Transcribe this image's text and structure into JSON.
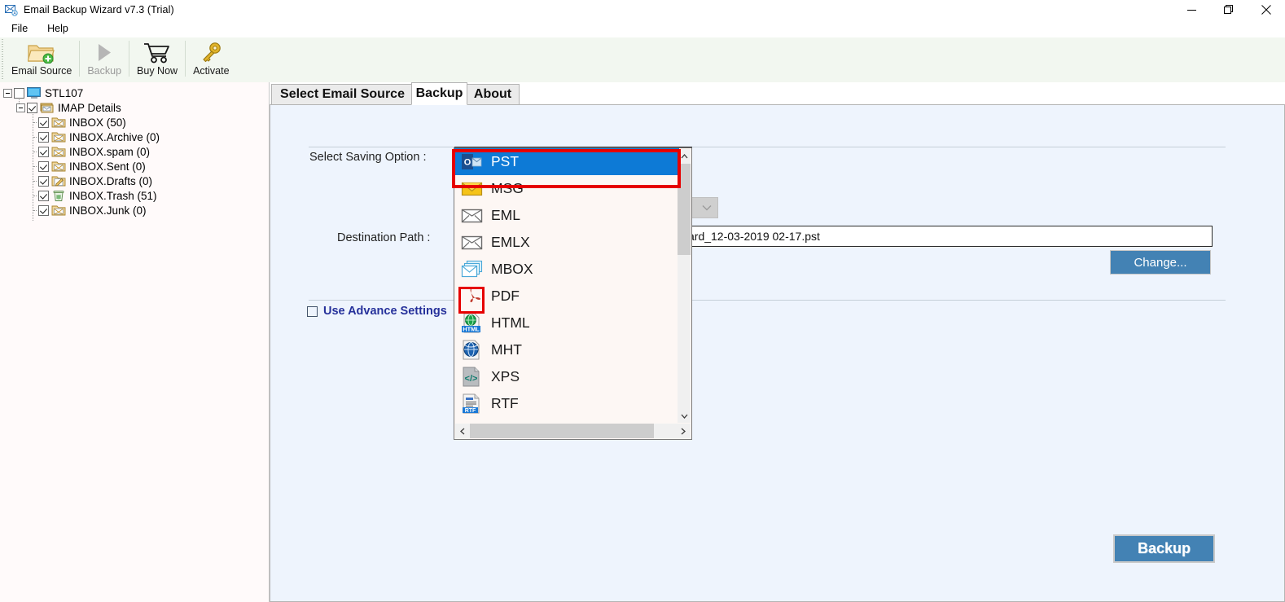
{
  "window": {
    "title": "Email Backup Wizard v7.3 (Trial)",
    "app_icon": "mail-envelope-icon",
    "controls": [
      {
        "name": "minimize-button",
        "glyph": "minimize-icon"
      },
      {
        "name": "maximize-button",
        "glyph": "restore-icon"
      },
      {
        "name": "close-button",
        "glyph": "close-icon"
      }
    ]
  },
  "menubar": {
    "items": [
      {
        "label": "File",
        "name": "menu-file"
      },
      {
        "label": "Help",
        "name": "menu-help"
      }
    ]
  },
  "toolbar": {
    "buttons": [
      {
        "label": "Email Source",
        "icon": "folder-add-icon",
        "name": "toolbar-email-source",
        "disabled": false
      },
      {
        "label": "Backup",
        "icon": "play-triangle-icon",
        "name": "toolbar-backup",
        "disabled": true
      },
      {
        "label": "Buy Now",
        "icon": "shopping-cart-icon",
        "name": "toolbar-buy-now",
        "disabled": false
      },
      {
        "label": "Activate",
        "icon": "key-icon",
        "name": "toolbar-activate",
        "disabled": false
      }
    ]
  },
  "tree": {
    "root": {
      "label": "STL107",
      "icon": "computer-icon",
      "checked": false,
      "expanded": true
    },
    "account": {
      "label": "IMAP Details",
      "icon": "mail-stack-icon",
      "checked": true,
      "expanded": true
    },
    "folders": [
      {
        "label": "INBOX (50)",
        "icon": "folder-mail-icon",
        "checked": true
      },
      {
        "label": "INBOX.Archive (0)",
        "icon": "folder-mail-icon",
        "checked": true
      },
      {
        "label": "INBOX.spam (0)",
        "icon": "folder-mail-icon",
        "checked": true
      },
      {
        "label": "INBOX.Sent (0)",
        "icon": "folder-mail-icon",
        "checked": true
      },
      {
        "label": "INBOX.Drafts (0)",
        "icon": "folder-draft-icon",
        "checked": true
      },
      {
        "label": "INBOX.Trash (51)",
        "icon": "trash-icon",
        "checked": true
      },
      {
        "label": "INBOX.Junk (0)",
        "icon": "folder-mail-icon",
        "checked": true
      }
    ]
  },
  "tabs": [
    {
      "label": "Select Email Source",
      "name": "tab-select-email-source",
      "active": false
    },
    {
      "label": "Backup",
      "name": "tab-backup",
      "active": true
    },
    {
      "label": "About",
      "name": "tab-about",
      "active": false
    }
  ],
  "backup_form": {
    "saving_option_label": "Select Saving Option :",
    "saving_option_value": "PST",
    "destination_label": "Destination Path :",
    "destination_value": "ard_12-03-2019 02-17.pst",
    "change_button": "Change...",
    "advance_label": "Use Advance Settings",
    "advance_checked": false,
    "backup_button": "Backup"
  },
  "dropdown": {
    "open": true,
    "selected": "PST",
    "options": [
      {
        "label": "PST",
        "icon": "outlook-pst-icon",
        "selected": true,
        "highlighted": true
      },
      {
        "label": "MSG",
        "icon": "msg-envelope-yellow-icon",
        "selected": false
      },
      {
        "label": "EML",
        "icon": "eml-envelope-icon",
        "selected": false
      },
      {
        "label": "EMLX",
        "icon": "emlx-envelope-icon",
        "selected": false
      },
      {
        "label": "MBOX",
        "icon": "mbox-stack-icon",
        "selected": false
      },
      {
        "label": "PDF",
        "icon": "pdf-icon",
        "selected": false,
        "outlined": true
      },
      {
        "label": "HTML",
        "icon": "html-globe-icon",
        "selected": false
      },
      {
        "label": "MHT",
        "icon": "mht-globe-icon",
        "selected": false
      },
      {
        "label": "XPS",
        "icon": "xps-code-icon",
        "selected": false
      },
      {
        "label": "RTF",
        "icon": "rtf-doc-icon",
        "selected": false
      }
    ]
  },
  "colors": {
    "accent_blue": "#0d7ad6",
    "panel_bg": "#eef4fd",
    "button_blue": "#4382b4",
    "highlight_red": "#e60000",
    "link_blue": "#26319b"
  }
}
